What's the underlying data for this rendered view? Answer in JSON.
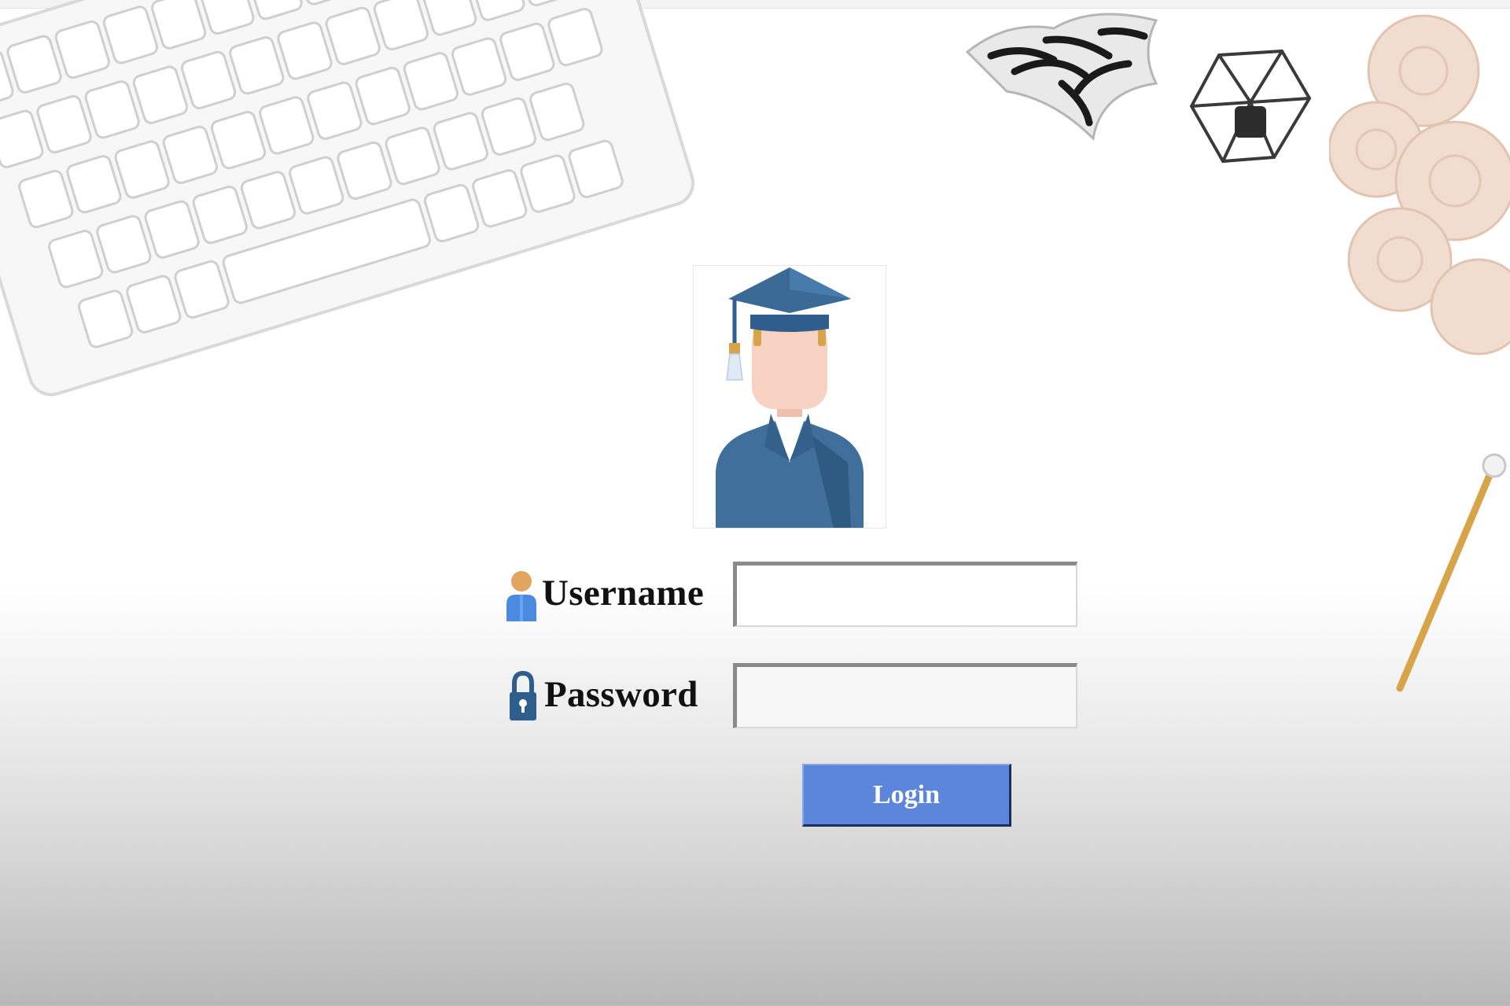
{
  "login_form": {
    "username_label": "Username",
    "password_label": "Password",
    "username_value": "",
    "password_value": "",
    "login_button_label": "Login"
  },
  "colors": {
    "button_blue": "#5b86db",
    "graduate_blue": "#2f5e8d",
    "skin": "#f5cdbd",
    "gold": "#d8a44a"
  },
  "icons": {
    "avatar": "graduate-avatar-icon",
    "username": "user-icon",
    "password": "lock-icon"
  }
}
